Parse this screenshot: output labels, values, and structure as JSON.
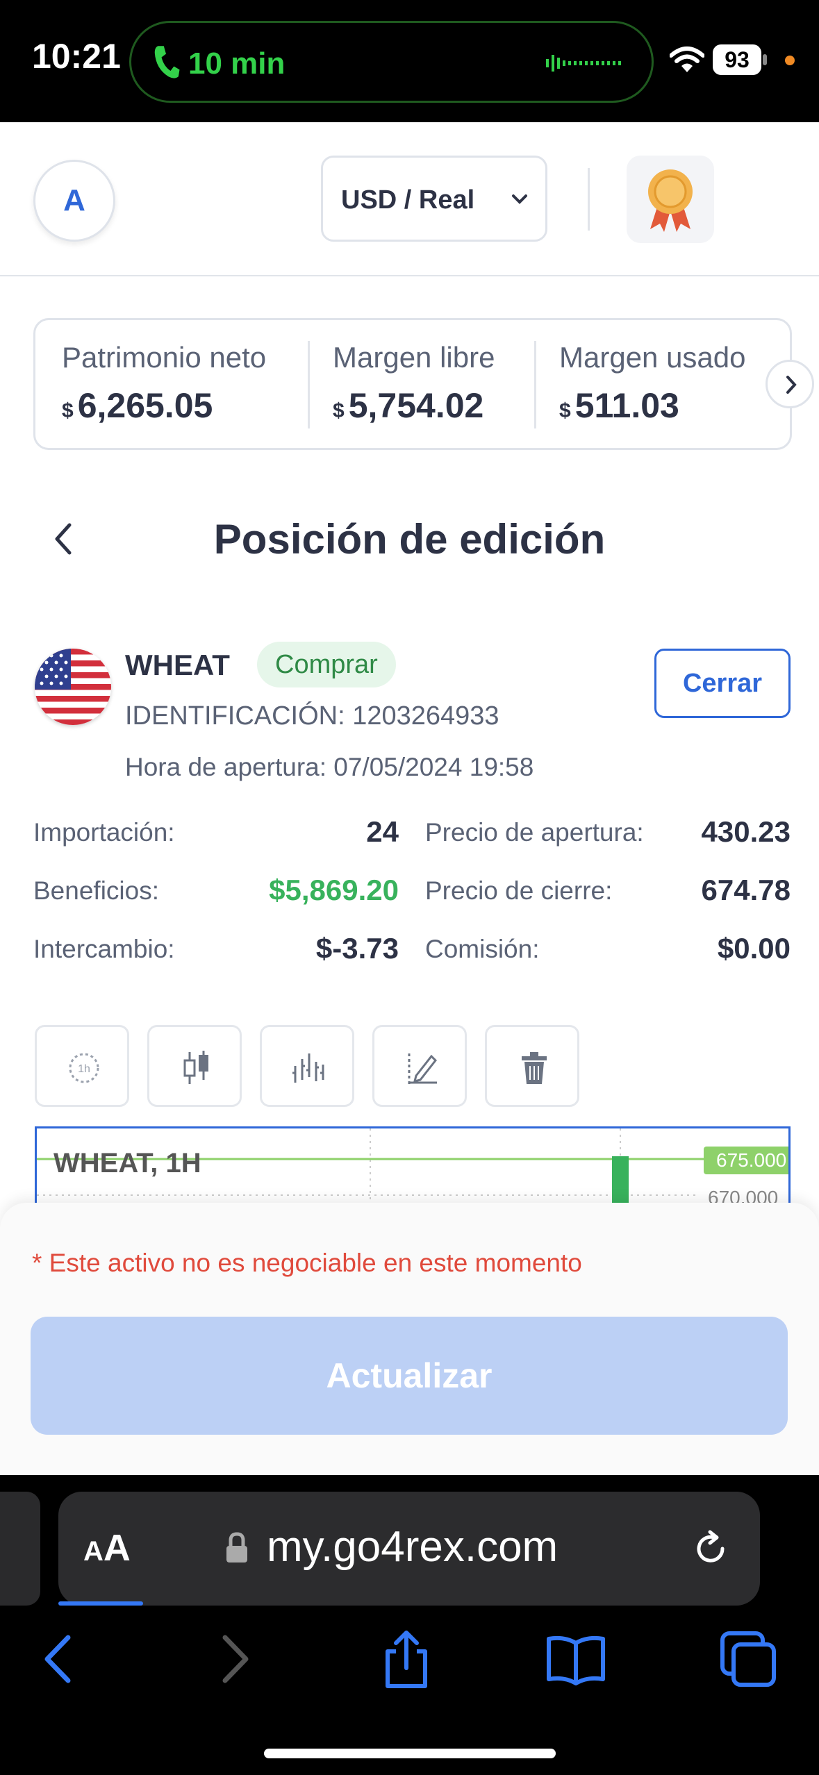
{
  "status_bar": {
    "time": "10:21",
    "call_duration": "10 min",
    "battery": "93"
  },
  "header": {
    "avatar_letter": "A",
    "account_selector": "USD / Real"
  },
  "account_stats": [
    {
      "label": "Patrimonio neto",
      "currency": "$",
      "value": "6,265.05"
    },
    {
      "label": "Margen libre",
      "currency": "$",
      "value": "5,754.02"
    },
    {
      "label": "Margen usado",
      "currency": "$",
      "value": "511.03"
    }
  ],
  "page": {
    "title": "Posición de edición"
  },
  "position": {
    "symbol": "WHEAT",
    "side": "Comprar",
    "id_text": "IDENTIFICACIÓN: 1203264933",
    "open_time_text": "Hora de apertura: 07/05/2024 19:58",
    "close_button": "Cerrar",
    "details_left": [
      {
        "label": "Importación:",
        "value": "24"
      },
      {
        "label": "Beneficios:",
        "value": "$5,869.20"
      },
      {
        "label": "Intercambio:",
        "value": "$-3.73"
      }
    ],
    "details_right": [
      {
        "label": "Precio de apertura:",
        "value": "430.23"
      },
      {
        "label": "Precio de cierre:",
        "value": "674.78"
      },
      {
        "label": "Comisión:",
        "value": "$0.00"
      }
    ]
  },
  "chart": {
    "title": "WHEAT, 1H",
    "price_high": "675.000",
    "price_low": "670.000"
  },
  "colors": {
    "accent": "#2f67d8",
    "positive": "#38b25c",
    "warning": "#e04a3c",
    "disabled_button": "#bcd0f5"
  },
  "bottom_sheet": {
    "warning": "* Este activo no es negociable en este momento",
    "update_button": "Actualizar"
  },
  "browser": {
    "reader_label_big": "A",
    "reader_label_small": "A",
    "url": "my.go4rex.com"
  }
}
